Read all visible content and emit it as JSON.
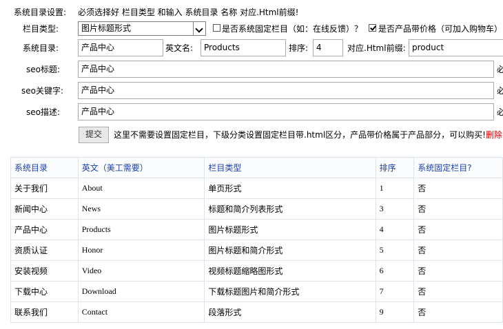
{
  "header": {
    "label": "系统目录设置:",
    "instruction": "必须选择好 栏目类型 和输入 系统目录 名称 对应.Html前缀!"
  },
  "form": {
    "type_label": "栏目类型:",
    "type_selected": "图片标题形式",
    "fixed_checkbox_label": "是否系统固定栏目（如：在线反馈）？",
    "fixed_checked": false,
    "price_checkbox_label": "是否产品带价格（可加入购物车）",
    "price_checked": true,
    "dir_label": "系统目录:",
    "dir_value": "产品中心",
    "en_label": "英文名:",
    "en_value": "Products",
    "order_label": "排序:",
    "order_value": "4",
    "html_label": "对应.Html前缀:",
    "html_value": "product",
    "seo_title_label": "seo标题:",
    "seo_title_value": "产品中心",
    "seo_kw_label": "seo关键字:",
    "seo_kw_value": "产品中心",
    "seo_desc_label": "seo描述:",
    "seo_desc_value": "产品中心",
    "required_mark": "必",
    "submit_label": "提交",
    "note": "这里不需要设置固定栏目，下级分类设置固定栏目带.html区分，产品带价格属于产品部分，可以购买!",
    "delete_label": "删除"
  },
  "table": {
    "headers": [
      "系统目录",
      "英文（美工需要）",
      "栏目类型",
      "排序",
      "系统固定栏目?"
    ],
    "rows": [
      [
        "关于我们",
        "About",
        "单页形式",
        "1",
        "否"
      ],
      [
        "新闻中心",
        "News",
        "标题和简介列表形式",
        "3",
        "否"
      ],
      [
        "产品中心",
        "Products",
        "图片标题形式",
        "4",
        "否"
      ],
      [
        "资质认证",
        "Honor",
        "图片标题和简介形式",
        "5",
        "否"
      ],
      [
        "安装视频",
        "Video",
        "视频标题缩略图形式",
        "6",
        "否"
      ],
      [
        "下载中心",
        "Download",
        "下载标题图片和简介形式",
        "7",
        "否"
      ],
      [
        "联系我们",
        "Contact",
        "段落形式",
        "9",
        "否"
      ]
    ]
  },
  "colors": {
    "header_text": "#1e3fa8",
    "delete_text": "#cc0000",
    "grid_border": "#dde4ee"
  }
}
